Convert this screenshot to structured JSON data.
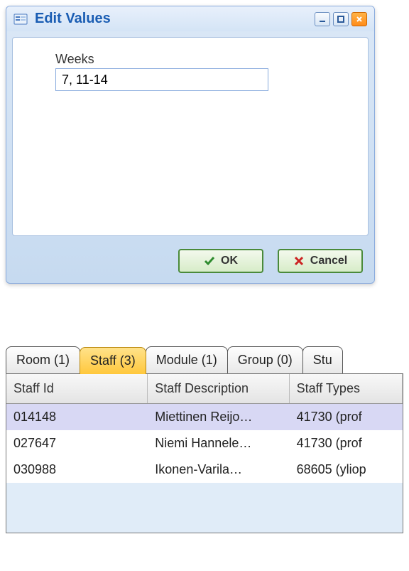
{
  "dialog": {
    "title": "Edit Values",
    "field_label": "Weeks",
    "field_value": "7, 11-14 ",
    "ok_label": "OK",
    "cancel_label": "Cancel"
  },
  "tabs": [
    {
      "label": "Room (1)",
      "active": false
    },
    {
      "label": "Staff (3)",
      "active": true
    },
    {
      "label": "Module (1)",
      "active": false
    },
    {
      "label": "Group (0)",
      "active": false
    },
    {
      "label": "Stu",
      "active": false
    }
  ],
  "grid": {
    "columns": [
      "Staff Id",
      "Staff Description",
      "Staff Types"
    ],
    "rows": [
      {
        "id": "014148",
        "desc": "Miettinen Reijo…",
        "type": "41730 (prof",
        "selected": true
      },
      {
        "id": "027647",
        "desc": "Niemi Hannele…",
        "type": "41730 (prof",
        "selected": false
      },
      {
        "id": "030988",
        "desc": "Ikonen-Varila…",
        "type": "68605 (yliop",
        "selected": false
      }
    ]
  }
}
